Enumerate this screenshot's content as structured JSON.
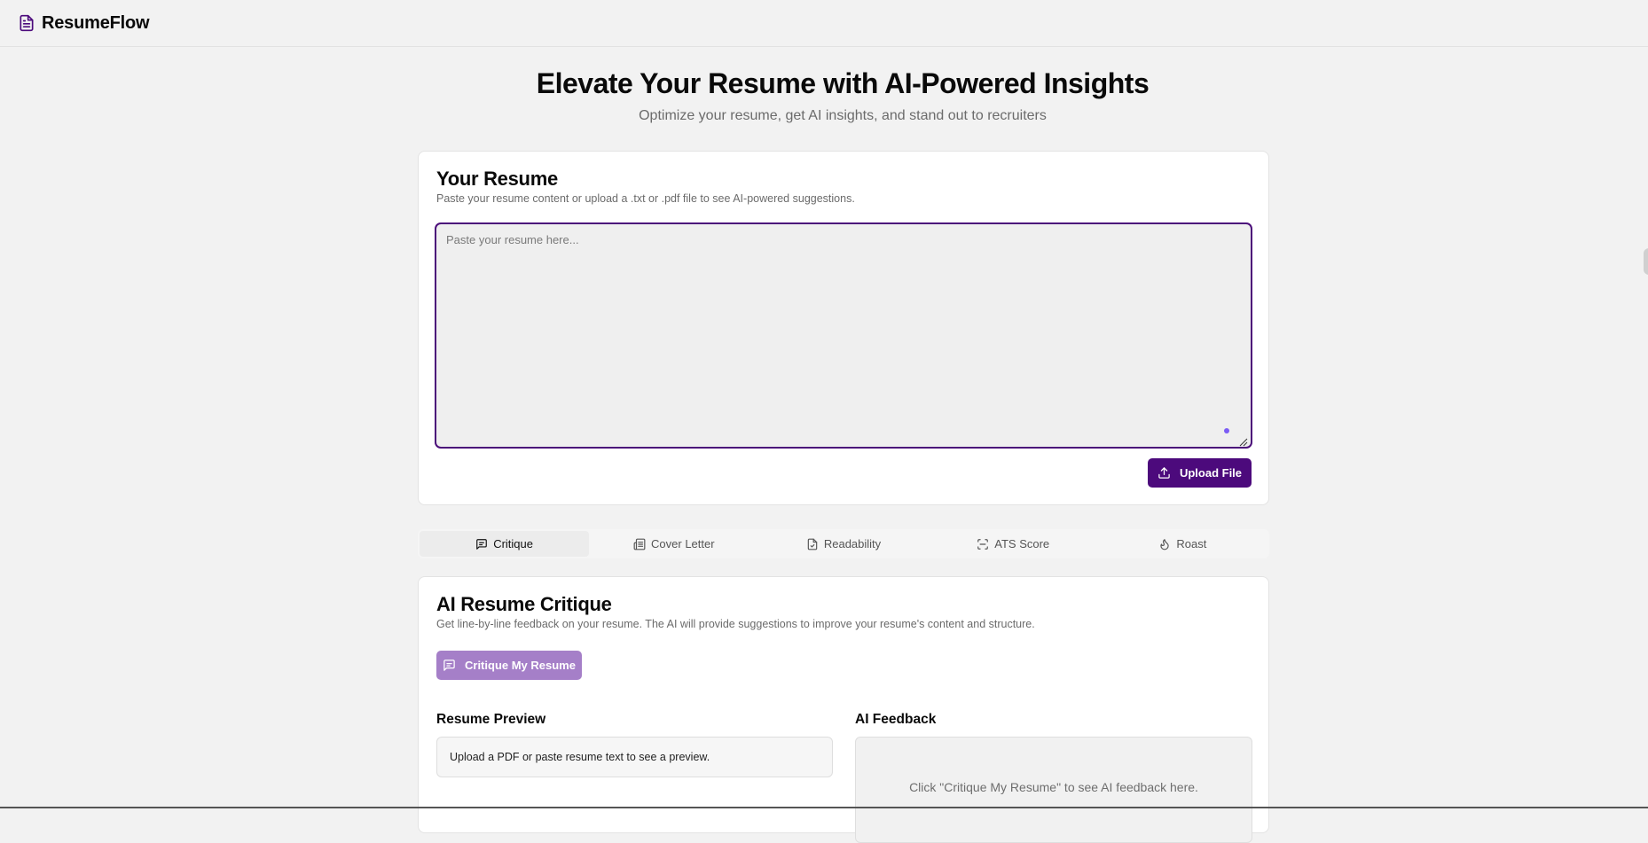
{
  "app": {
    "brand": "ResumeFlow"
  },
  "hero": {
    "title": "Elevate Your Resume with AI-Powered Insights",
    "subtitle": "Optimize your resume, get AI insights, and stand out to recruiters"
  },
  "resume_card": {
    "title": "Your Resume",
    "description": "Paste your resume content or upload a .txt or .pdf file to see AI-powered suggestions.",
    "input_placeholder": "Paste your resume here...",
    "input_value": "",
    "upload_label": "Upload File"
  },
  "tabs": [
    {
      "label": "Critique",
      "icon": "message-square-icon",
      "active": true
    },
    {
      "label": "Cover Letter",
      "icon": "newspaper-icon",
      "active": false
    },
    {
      "label": "Readability",
      "icon": "file-check-icon",
      "active": false
    },
    {
      "label": "ATS Score",
      "icon": "scan-icon",
      "active": false
    },
    {
      "label": "Roast",
      "icon": "flame-icon",
      "active": false
    }
  ],
  "critique": {
    "title": "AI Resume Critique",
    "description": "Get line-by-line feedback on your resume. The AI will provide suggestions to improve your resume's content and structure.",
    "button_label": "Critique My Resume",
    "preview_heading": "Resume Preview",
    "preview_empty": "Upload a PDF or paste resume text to see a preview.",
    "feedback_heading": "AI Feedback",
    "feedback_empty": "Click \"Critique My Resume\" to see AI feedback here."
  },
  "colors": {
    "primary": "#4c0a7c",
    "primary_disabled": "#a57fc8",
    "page_background": "#f2f2f2",
    "card_background": "#ffffff"
  }
}
